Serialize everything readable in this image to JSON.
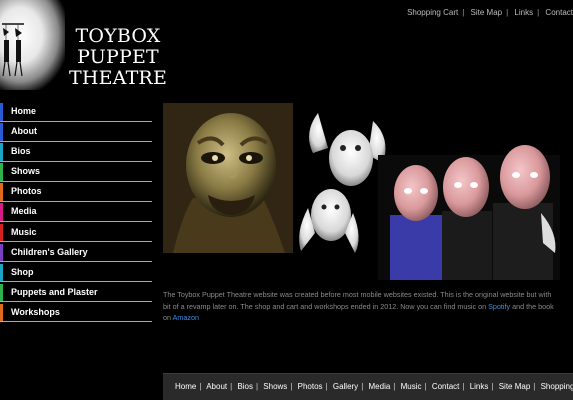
{
  "site": {
    "title_line1": "TOYBOX PUPPET",
    "title_line2": "THEATRE"
  },
  "top_nav": [
    "Shopping Cart",
    "Site Map",
    "Links",
    "Contact"
  ],
  "side_nav": [
    {
      "label": "Home",
      "accent": "#2a5bd7"
    },
    {
      "label": "About",
      "accent": "#2a5bd7"
    },
    {
      "label": "Bios",
      "accent": "#1aa3c4"
    },
    {
      "label": "Shows",
      "accent": "#2db34a"
    },
    {
      "label": "Photos",
      "accent": "#e06a1c"
    },
    {
      "label": "Media",
      "accent": "#d81b8a"
    },
    {
      "label": "Music",
      "accent": "#d32020"
    },
    {
      "label": "Children's Gallery",
      "accent": "#7a3fc0"
    },
    {
      "label": "Shop",
      "accent": "#1aa3c4"
    },
    {
      "label": "Puppets and Plaster",
      "accent": "#2db34a"
    },
    {
      "label": "Workshops",
      "accent": "#e06a1c"
    }
  ],
  "description": {
    "line1": "The Toybox Puppet Theatre website was created before most mobile websites existed. This is the original website but with",
    "line2_a": "bit of a revamp later on. The shop and cart and workshops ended in 2012. Now you can find music on",
    "spotify": "Spotify",
    "line2_b": "and the book",
    "line3_a": "on",
    "amazon": "Amazon"
  },
  "footer_nav": [
    "Home",
    "About",
    "Bios",
    "Shows",
    "Photos",
    "Gallery",
    "Media",
    "Music",
    "Contact",
    "Links",
    "Site Map",
    "Shopping Cart"
  ],
  "colors": {
    "link": "#3a8de0"
  }
}
